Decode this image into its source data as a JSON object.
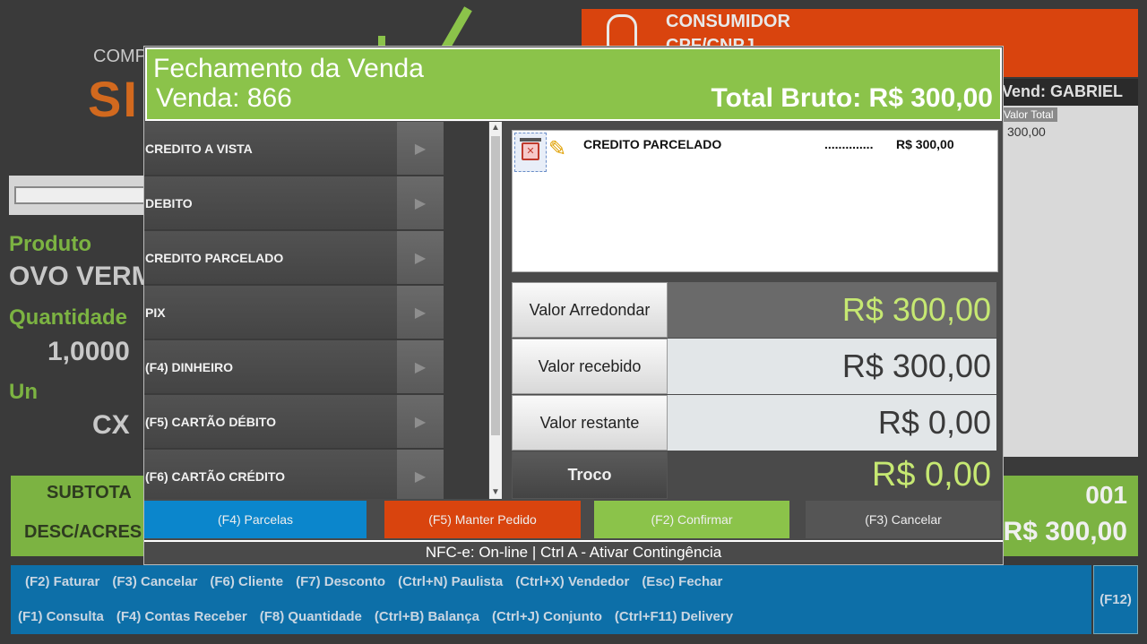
{
  "background": {
    "brand_small": "COMP",
    "brand_big": "SI",
    "consumer_label": "CONSUMIDOR",
    "consumer_doc": "CPF/CNPJ",
    "vendor": "Vend: GABRIEL",
    "table_header": "Valor Total",
    "table_value": "300,00",
    "produto_label": "Produto",
    "produto_value": "OVO VERM",
    "quantidade_label": "Quantidade",
    "quantidade_value": "1,0000",
    "unidade_label": "Un",
    "unidade_value": "CX",
    "subtotal_label": "SUBTOTA",
    "desc_label": "DESC/ACRES",
    "item_count": "001",
    "subtotal_value": "R$ 300,00",
    "shortcuts_row1": [
      "(F2) Faturar",
      "(F3) Cancelar",
      "(F6) Cliente",
      "(F7) Desconto",
      "(Ctrl+N) Paulista",
      "(Ctrl+X) Vendedor",
      "(Esc) Fechar"
    ],
    "shortcuts_row2": [
      "(F1) Consulta",
      "(F4) Contas Receber",
      "(F8) Quantidade",
      "(Ctrl+B) Balança",
      "(Ctrl+J) Conjunto",
      "(Ctrl+F11) Delivery"
    ],
    "f12": "(F12)"
  },
  "modal": {
    "title": "Fechamento da Venda",
    "sale": "Venda: 866",
    "total": "Total Bruto: R$ 300,00",
    "methods": [
      {
        "label": "CREDITO A VISTA"
      },
      {
        "label": "DEBITO"
      },
      {
        "label": "CREDITO PARCELADO"
      },
      {
        "label": "PIX"
      },
      {
        "label": "(F4) DINHEIRO"
      },
      {
        "label": "(F5) CARTÃO DÉBITO"
      },
      {
        "label": "(F6) CARTÃO CRÉDITO"
      }
    ],
    "payment": {
      "desc": "CREDITO PARCELADO",
      "dots": "..............",
      "value": "R$ 300,00"
    },
    "values": {
      "arredondar_label": "Valor Arredondar",
      "arredondar_value": "R$ 300,00",
      "recebido_label": "Valor recebido",
      "recebido_value": "R$ 300,00",
      "restante_label": "Valor restante",
      "restante_value": "R$ 0,00",
      "troco_label": "Troco",
      "troco_value": "R$ 0,00"
    },
    "actions": {
      "parcelas": "(F4) Parcelas",
      "manter": "(F5) Manter Pedido",
      "confirmar": "(F2) Confirmar",
      "cancelar": "(F3) Cancelar"
    },
    "colors": {
      "parcelas": "#0b86cc",
      "manter": "#d9440e",
      "confirmar": "#8bc34a",
      "cancelar": "#555555"
    },
    "status": "NFC-e: On-line | Ctrl A - Ativar Contingência"
  }
}
